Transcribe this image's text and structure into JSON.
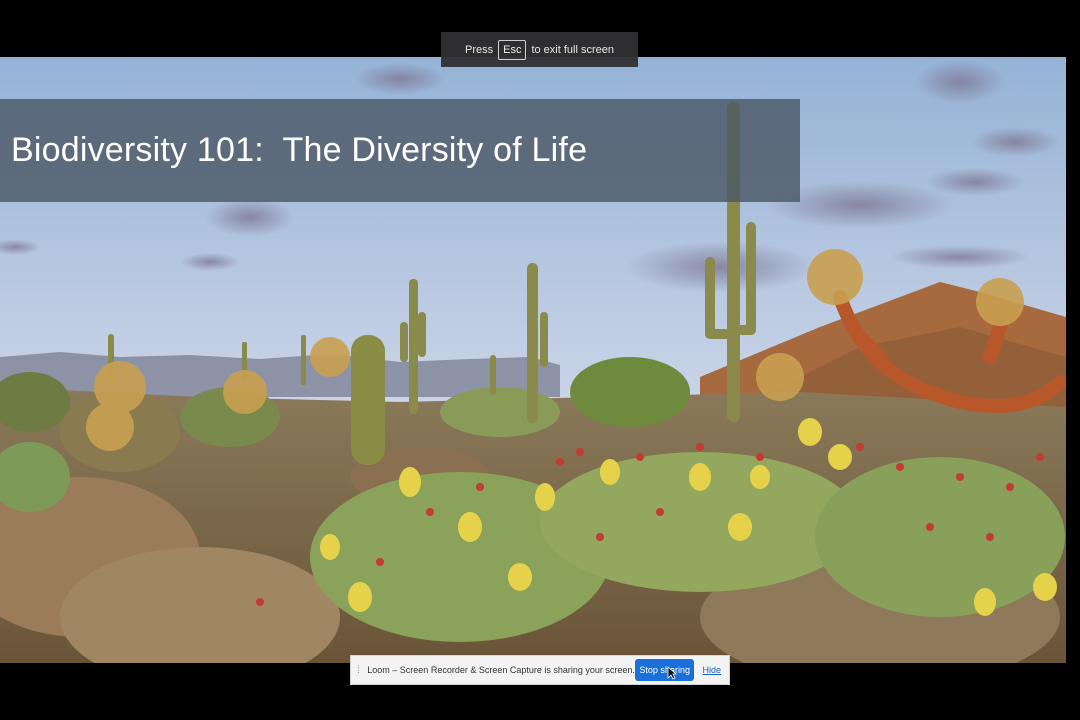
{
  "fullscreen_hint": {
    "prefix": "Press",
    "key": "Esc",
    "suffix": "to exit full screen"
  },
  "slide": {
    "title": "Biodiversity 101:  The Diversity of Life"
  },
  "share_bar": {
    "message": "Loom – Screen Recorder & Screen Capture is sharing your screen.",
    "stop_label": "Stop sharing",
    "hide_label": "Hide"
  },
  "colors": {
    "sky_top": "#9bb6d8",
    "sky_bottom": "#dfe4ee",
    "title_band": "#4a5664",
    "stop_button": "#1a6fd8"
  }
}
